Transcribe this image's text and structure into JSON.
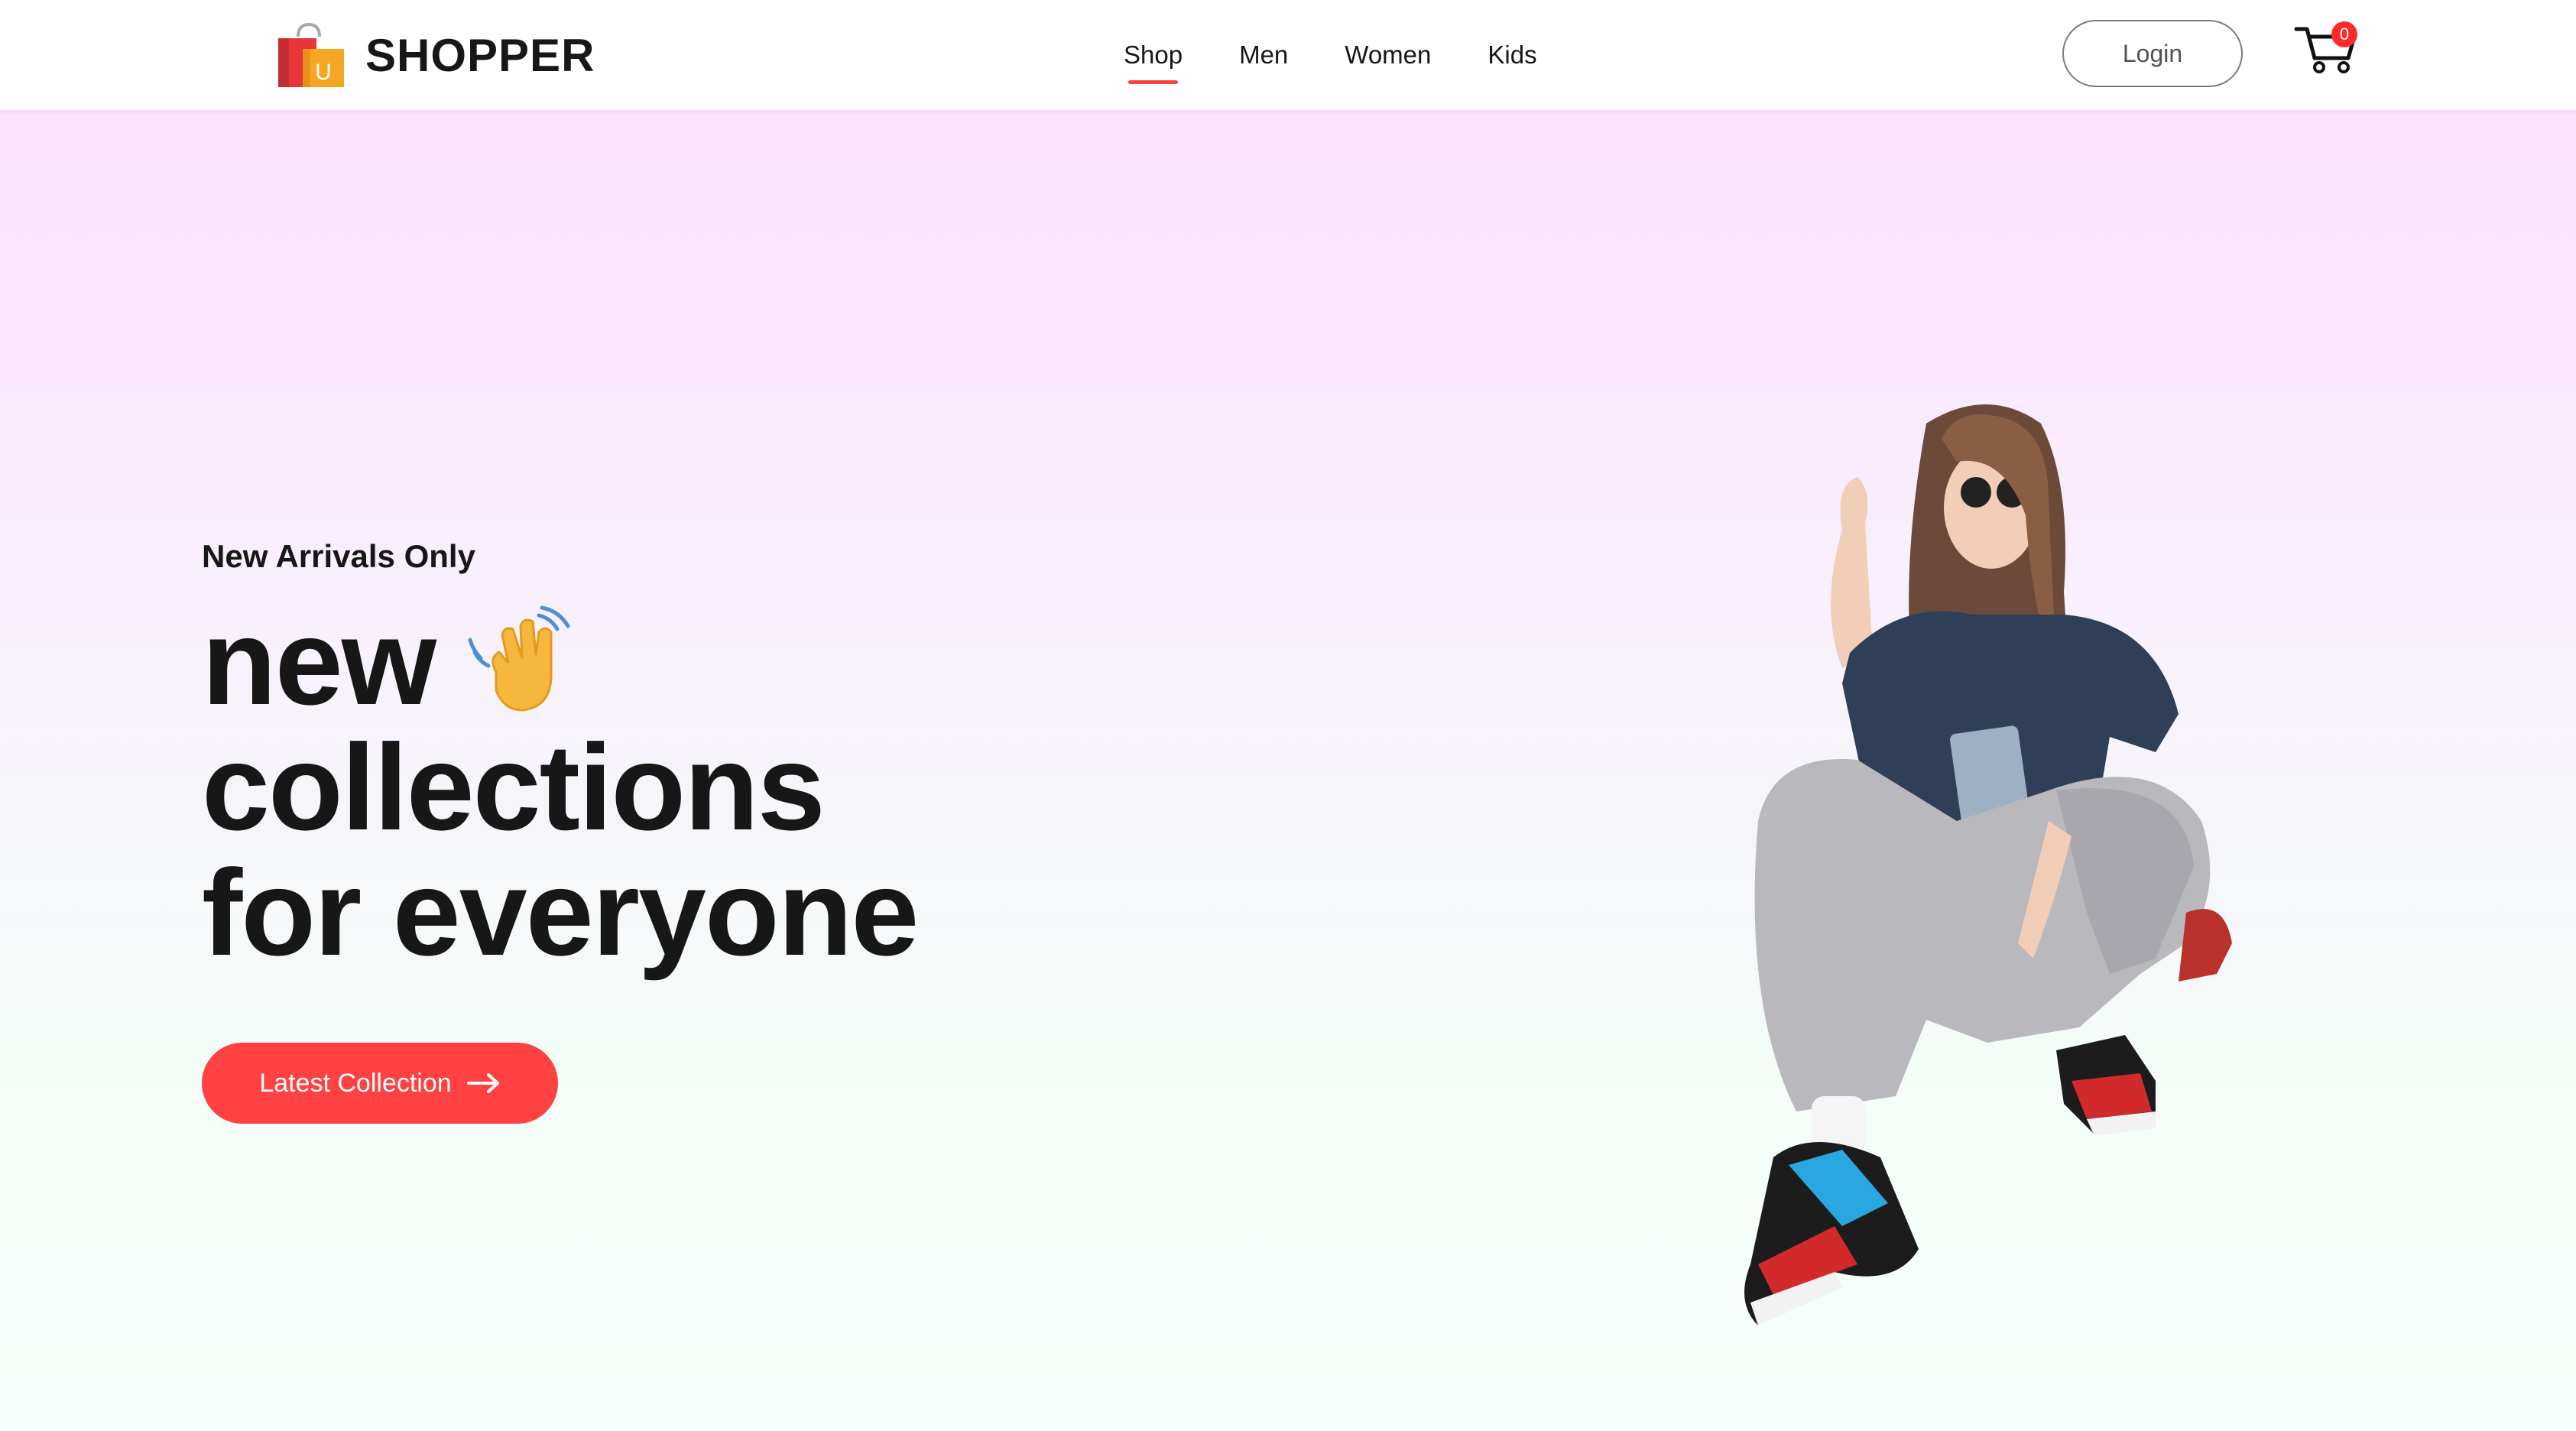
{
  "brand": {
    "name": "SHOPPER"
  },
  "nav": {
    "items": [
      {
        "label": "Shop",
        "active": true
      },
      {
        "label": "Men",
        "active": false
      },
      {
        "label": "Women",
        "active": false
      },
      {
        "label": "Kids",
        "active": false
      }
    ],
    "login_label": "Login",
    "cart_count": "0"
  },
  "hero": {
    "tag": "New Arrivals Only",
    "line1": "new",
    "line2": "collections",
    "line3": "for everyone",
    "cta_label": "Latest Collection"
  },
  "colors": {
    "accent": "#ff4141",
    "text": "#171717",
    "gradient_top": "#fde1ff",
    "gradient_bottom": "#f6fffb"
  },
  "icons": {
    "logo": "shopping-bag-icon",
    "cart": "cart-icon",
    "hand": "waving-hand-icon",
    "arrow": "arrow-right-icon"
  }
}
